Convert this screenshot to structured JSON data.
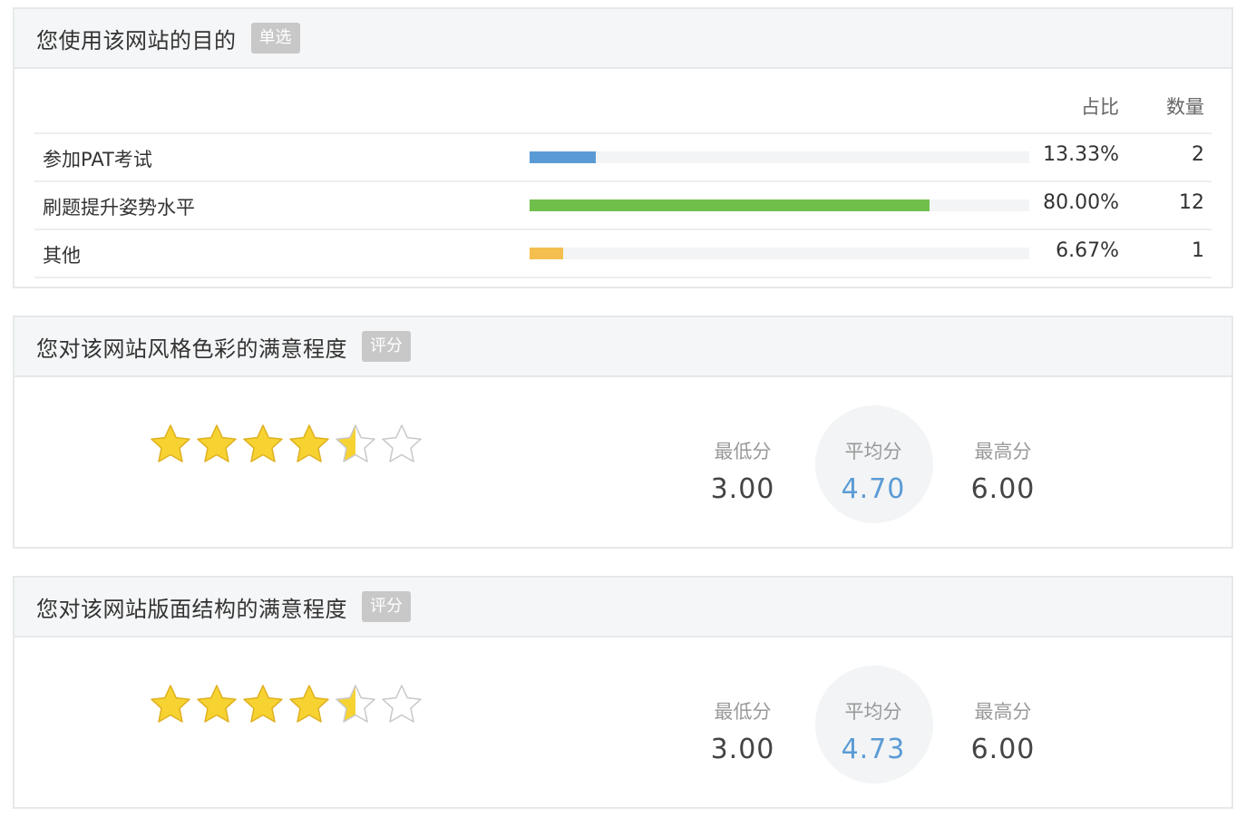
{
  "purpose": {
    "title": "您使用该网站的目的",
    "badge": "单选",
    "header_ratio": "占比",
    "header_count": "数量",
    "options": [
      {
        "label": "参加PAT考试",
        "ratio": "13.33%",
        "count": "2",
        "fraction": 0.1333,
        "color": "#5b9bd5"
      },
      {
        "label": "刷题提升姿势水平",
        "ratio": "80.00%",
        "count": "12",
        "fraction": 0.8,
        "color": "#70bf4b"
      },
      {
        "label": "其他",
        "ratio": "6.67%",
        "count": "1",
        "fraction": 0.0667,
        "color": "#f5bf4f"
      }
    ]
  },
  "color_rating": {
    "title": "您对该网站风格色彩的满意程度",
    "badge": "评分",
    "stars_filled": 4.5,
    "stars_total": 6,
    "min_label": "最低分",
    "min_value": "3.00",
    "avg_label": "平均分",
    "avg_value": "4.70",
    "max_label": "最高分",
    "max_value": "6.00"
  },
  "layout_rating": {
    "title": "您对该网站版面结构的满意程度",
    "badge": "评分",
    "stars_filled": 4.5,
    "stars_total": 6,
    "min_label": "最低分",
    "min_value": "3.00",
    "avg_label": "平均分",
    "avg_value": "4.73",
    "max_label": "最高分",
    "max_value": "6.00"
  },
  "colors": {
    "star_fill": "#f7d332",
    "star_stroke": "#e0b020",
    "star_empty_stroke": "#c8c8c8",
    "avg_text": "#5b9bd5"
  }
}
